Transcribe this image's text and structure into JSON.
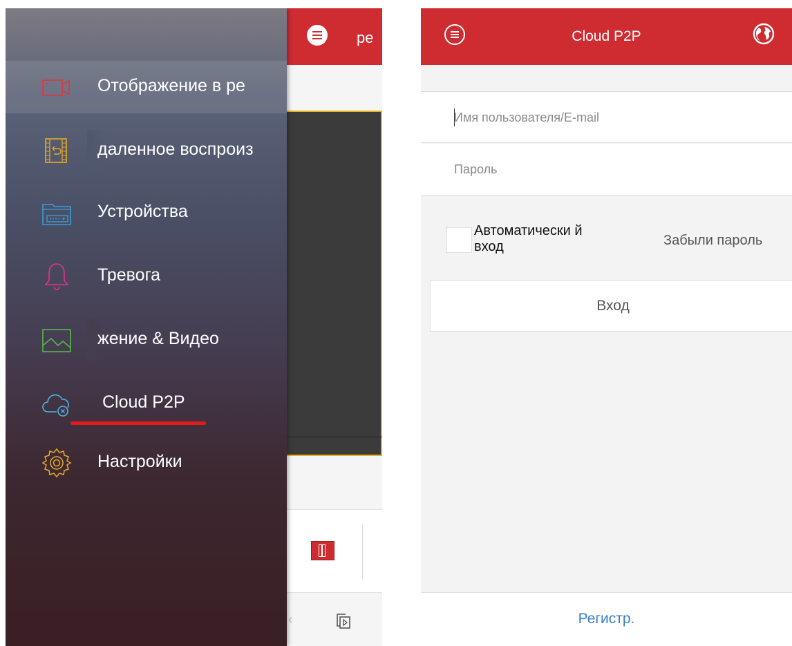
{
  "left": {
    "background_title_fragment": "ре",
    "drawer_items": [
      {
        "label": "Отображение в ре",
        "icon": "video-camera-icon"
      },
      {
        "label": "даленное воспроиз",
        "icon": "playback-film-icon"
      },
      {
        "label": "Устройства",
        "icon": "device-folder-icon"
      },
      {
        "label": "Тревога",
        "icon": "alarm-bell-icon"
      },
      {
        "label": "жение & Видео",
        "icon": "image-picture-icon"
      },
      {
        "label": "Cloud P2P",
        "icon": "cloud-icon"
      },
      {
        "label": "Настройки",
        "icon": "settings-gear-icon"
      }
    ]
  },
  "right": {
    "title": "Cloud P2P",
    "username": {
      "placeholder": "Имя пользователя/E-mail",
      "value": ""
    },
    "password": {
      "placeholder": "Пароль",
      "value": ""
    },
    "auto_login_label": "Автоматически й вход",
    "auto_login_checked": false,
    "forgot_password": "Забыли пароль",
    "login_button": "Вход",
    "register_link": "Регистр."
  },
  "colors": {
    "accent_red": "#cf2c32",
    "link_blue": "#3a7fc8",
    "highlight_yellow": "#e8b21e",
    "underline_red": "#e21c1c"
  }
}
